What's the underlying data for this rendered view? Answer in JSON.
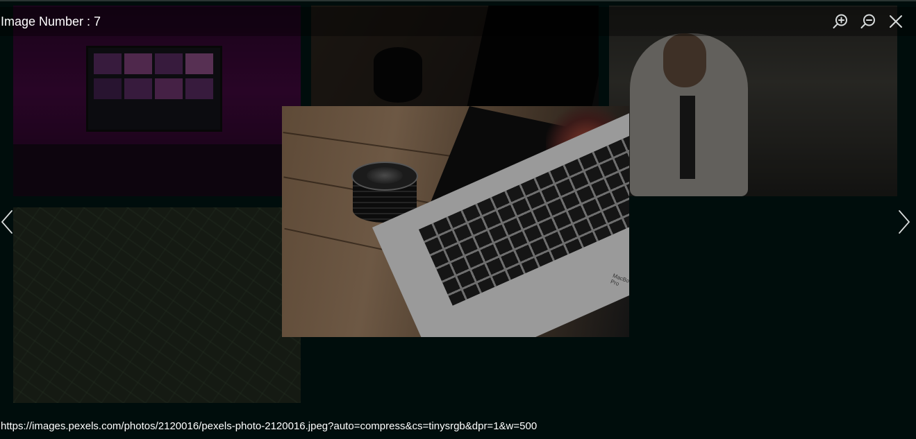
{
  "viewer": {
    "title": "Image Number : 7",
    "source_url": "https://images.pexels.com/photos/2120016/pexels-photo-2120016.jpeg?auto=compress&cs=tinysrgb&dpr=1&w=500"
  },
  "toolbar": {
    "icons": [
      "zoom-in-icon",
      "zoom-out-icon",
      "close-icon"
    ]
  },
  "navigation": {
    "icons": [
      "chevron-left-icon",
      "chevron-right-icon"
    ]
  },
  "main_photo": {
    "brand_text": "MacBook Pro"
  },
  "colors": {
    "backdrop": "#000d0c",
    "text": "#ffffff",
    "icon": "#d8dcdc"
  }
}
